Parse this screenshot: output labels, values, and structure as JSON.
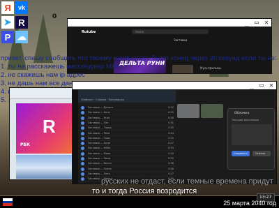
{
  "desktop": {
    "counter": "0",
    "icons": [
      {
        "name": "yandex-icon",
        "glyph": "Я",
        "bg": "#ffffff",
        "fg": "#fc3f1d"
      },
      {
        "name": "vk-icon",
        "glyph": "vk",
        "bg": "#0077ff",
        "fg": "#ffffff"
      },
      {
        "name": "telegram-icon",
        "glyph": "➤",
        "bg": "#ffffff",
        "fg": "#2aa3df"
      },
      {
        "name": "rutube-icon",
        "glyph": "R",
        "bg": "#100943",
        "fg": "#ffffff"
      },
      {
        "name": "app-p-icon",
        "glyph": "P",
        "bg": "#3b4fe0",
        "fg": "#ffffff"
      },
      {
        "name": "cloud-icon",
        "glyph": "☁",
        "bg": "#6ec3ff",
        "fg": "#ffffff"
      }
    ]
  },
  "message": {
    "lines": [
      "привет, спешу сообщить что твоему компьютеру будет конец через 20 секунд если ты не:",
      "1. ты не расскажешь мессенджер MAX",
      "2. не скажешь нам ip адрес",
      "3. не дашь нам все данные",
      "4. не запустишь мессен...",
      "5. ..."
    ]
  },
  "rutube_window": {
    "controls": "_ ▭ ✕",
    "logo": "Rutube",
    "search": "поиск",
    "channel": "Заставки",
    "video_title": "ДЕЛЬТА РУНИ",
    "subtitle": "Заставки",
    "more_title": "Мультфильмы"
  },
  "player_window": {
    "controls": "_ ▭ ✕",
    "tabs": [
      "Главная",
      "Плейлист",
      "Трансляции"
    ],
    "header": "Плейлист · Главная · Популярное",
    "rows": [
      {
        "t": "Заставки — Дельта",
        "d": "0:12"
      },
      {
        "t": "Заставки — Ночь",
        "d": "0:25"
      },
      {
        "t": "Заставки — Утро",
        "d": "0:18"
      },
      {
        "t": "Заставки — Лес",
        "d": "0:31"
      },
      {
        "t": "Заставки — Город",
        "d": "0:20"
      },
      {
        "t": "Заставки — Река",
        "d": "0:44"
      },
      {
        "t": "Заставки — Горы",
        "d": "0:15"
      },
      {
        "t": "Заставки — Поле",
        "d": "0:27"
      },
      {
        "t": "Заставки — Небо",
        "d": "0:33"
      },
      {
        "t": "Заставки — Море",
        "d": "0:19"
      },
      {
        "t": "Заставки — Зима",
        "d": "0:22"
      },
      {
        "t": "Заставки — Весна",
        "d": "0:38"
      },
      {
        "t": "Заставки — Осень",
        "d": "0:26"
      },
      {
        "t": "Заставки — Лето",
        "d": "0:17"
      },
      {
        "t": "Заставки — Финал",
        "d": "0:40"
      }
    ],
    "panel_title": "Обложка",
    "panel_text": "Текущая трансляция",
    "button_ok": "Сохранить",
    "button_cancel": "Отмена"
  },
  "browser_window": {
    "brand": "R",
    "brand_text": "РБК"
  },
  "captions": [
    "русских не отдаст, если темные времена придут",
    "то и тогда Россия возродится"
  ],
  "taskbar": {
    "flag_colors": [
      "#ffffff",
      "#0039a6",
      "#d52b1e"
    ],
    "time": "13:27",
    "date": "25 марта 2040 год"
  }
}
